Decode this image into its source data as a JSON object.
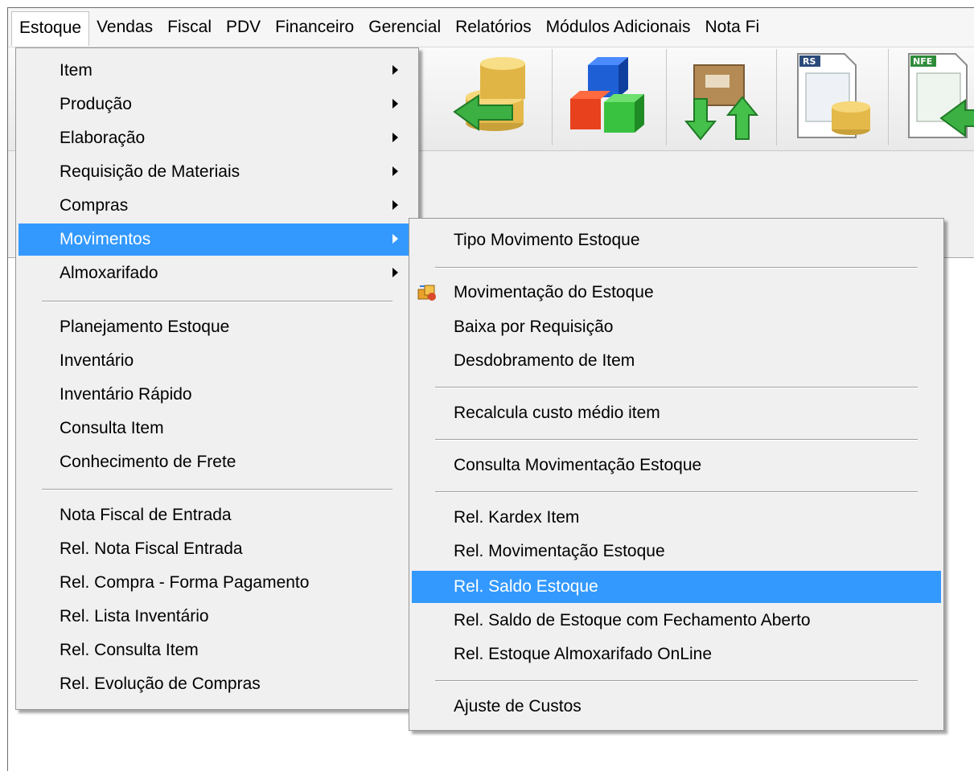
{
  "menubar": {
    "items": [
      "Estoque",
      "Vendas",
      "Fiscal",
      "PDV",
      "Financeiro",
      "Gerencial",
      "Relatórios",
      "Módulos Adicionais",
      "Nota Fi"
    ]
  },
  "toolbar": {
    "buttons": [
      {
        "icon": "coins-arrow-in-icon"
      },
      {
        "icon": "cubes-icon"
      },
      {
        "icon": "box-transfer-icon"
      },
      {
        "icon": "rs-report-coins-icon",
        "badge": "RS"
      },
      {
        "icon": "nfe-document-icon",
        "badge": "NFE"
      }
    ]
  },
  "estoque_menu": {
    "items": [
      {
        "label": "Item",
        "submenu": true
      },
      {
        "label": "Produção",
        "submenu": true
      },
      {
        "label": "Elaboração",
        "submenu": true
      },
      {
        "label": "Requisição de Materiais",
        "submenu": true
      },
      {
        "label": "Compras",
        "submenu": true
      },
      {
        "label": "Movimentos",
        "submenu": true,
        "highlighted": true
      },
      {
        "label": "Almoxarifado",
        "submenu": true
      },
      {
        "label": "Planejamento Estoque"
      },
      {
        "label": "Inventário"
      },
      {
        "label": "Inventário Rápido"
      },
      {
        "label": "Consulta Item"
      },
      {
        "label": "Conhecimento de Frete"
      },
      {
        "label": "Nota Fiscal de Entrada"
      },
      {
        "label": "Rel. Nota Fiscal Entrada"
      },
      {
        "label": "Rel. Compra - Forma Pagamento"
      },
      {
        "label": "Rel. Lista Inventário"
      },
      {
        "label": "Rel. Consulta Item"
      },
      {
        "label": "Rel. Evolução de Compras"
      }
    ]
  },
  "movimentos_menu": {
    "items": [
      {
        "label": "Tipo Movimento Estoque"
      },
      {
        "label": "Movimentação do Estoque",
        "icon": "stock-movement-icon"
      },
      {
        "label": "Baixa por Requisição"
      },
      {
        "label": "Desdobramento de Item"
      },
      {
        "label": "Recalcula custo médio item"
      },
      {
        "label": "Consulta Movimentação Estoque"
      },
      {
        "label": "Rel. Kardex Item"
      },
      {
        "label": "Rel. Movimentação Estoque"
      },
      {
        "label": "Rel. Saldo Estoque",
        "highlighted": true
      },
      {
        "label": "Rel. Saldo de Estoque com Fechamento Aberto"
      },
      {
        "label": "Rel. Estoque Almoxarifado OnLine"
      },
      {
        "label": "Ajuste de Custos"
      }
    ]
  },
  "colors": {
    "highlight": "#3399ff",
    "menu_bg": "#f0f0f0"
  }
}
